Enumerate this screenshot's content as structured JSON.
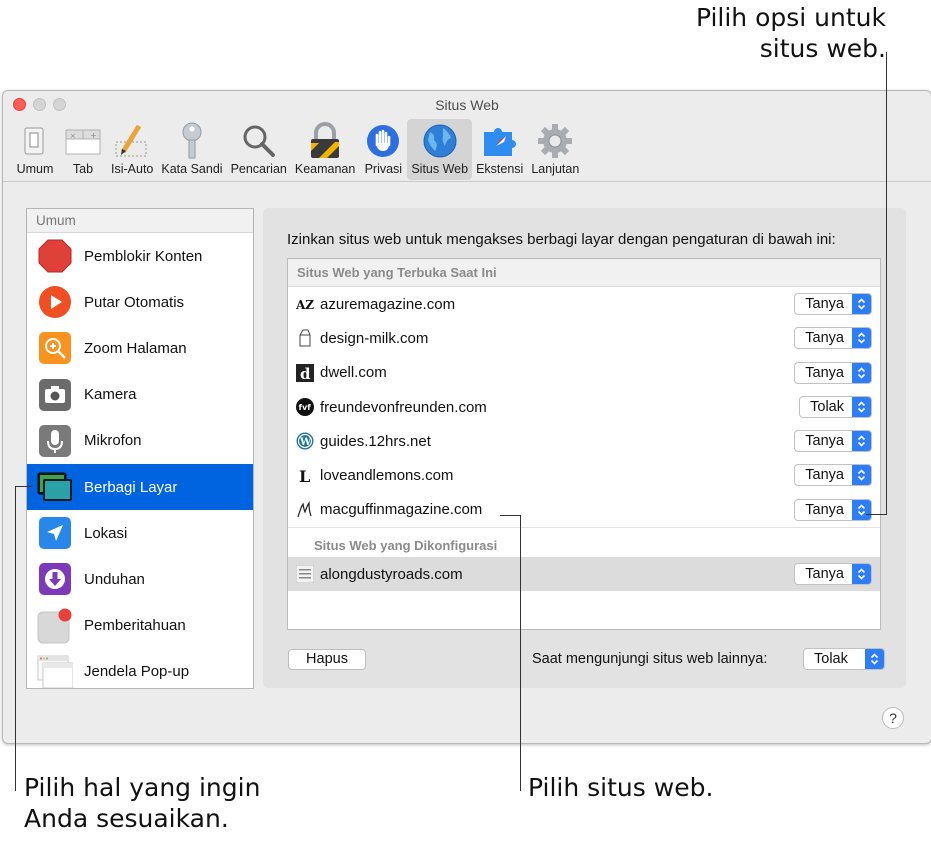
{
  "window": {
    "title": "Situs Web"
  },
  "toolbar": {
    "items": [
      {
        "label": "Umum",
        "icon": "switch-icon"
      },
      {
        "label": "Tab",
        "icon": "tabs-icon"
      },
      {
        "label": "Isi-Auto",
        "icon": "pencil-icon"
      },
      {
        "label": "Kata Sandi",
        "icon": "key-icon"
      },
      {
        "label": "Pencarian",
        "icon": "magnifier-icon"
      },
      {
        "label": "Keamanan",
        "icon": "lock-icon"
      },
      {
        "label": "Privasi",
        "icon": "hand-icon"
      },
      {
        "label": "Situs Web",
        "icon": "globe-icon",
        "active": true
      },
      {
        "label": "Ekstensi",
        "icon": "puzzle-compass-icon"
      },
      {
        "label": "Lanjutan",
        "icon": "gear-icon"
      }
    ]
  },
  "sidebar": {
    "header": "Umum",
    "items": [
      {
        "label": "Pemblokir Konten",
        "icon": "stop-sign-icon"
      },
      {
        "label": "Putar Otomatis",
        "icon": "play-icon"
      },
      {
        "label": "Zoom Halaman",
        "icon": "zoom-icon"
      },
      {
        "label": "Kamera",
        "icon": "camera-icon"
      },
      {
        "label": "Mikrofon",
        "icon": "microphone-icon"
      },
      {
        "label": "Berbagi Layar",
        "icon": "screen-share-icon",
        "selected": true
      },
      {
        "label": "Lokasi",
        "icon": "location-arrow-icon"
      },
      {
        "label": "Unduhan",
        "icon": "download-icon"
      },
      {
        "label": "Pemberitahuan",
        "icon": "notification-icon"
      },
      {
        "label": "Jendela Pop-up",
        "icon": "popup-window-icon"
      }
    ]
  },
  "main": {
    "instructions": "Izinkan situs web untuk mengakses berbagi layar dengan pengaturan di bawah ini:",
    "open_header": "Situs Web yang Terbuka Saat Ini",
    "configured_header": "Situs Web yang Dikonfigurasi",
    "open_sites": [
      {
        "name": "azuremagazine.com",
        "value": "Tanya",
        "icon": "az-favicon"
      },
      {
        "name": "design-milk.com",
        "value": "Tanya",
        "icon": "milk-carton-favicon"
      },
      {
        "name": "dwell.com",
        "value": "Tanya",
        "icon": "d-favicon"
      },
      {
        "name": "freundevonfreunden.com",
        "value": "Tolak",
        "icon": "fvf-favicon"
      },
      {
        "name": "guides.12hrs.net",
        "value": "Tanya",
        "icon": "wordpress-favicon"
      },
      {
        "name": "loveandlemons.com",
        "value": "Tanya",
        "icon": "l-favicon"
      },
      {
        "name": "macguffinmagazine.com",
        "value": "Tanya",
        "icon": "m-script-favicon"
      }
    ],
    "configured_sites": [
      {
        "name": "alongdustyroads.com",
        "value": "Tanya",
        "icon": "along-dusty-roads-favicon",
        "selected": true
      }
    ],
    "remove_button": "Hapus",
    "other_label": "Saat mengunjungi situs web lainnya:",
    "other_value": "Tolak",
    "help": "?"
  },
  "callouts": {
    "top_right": [
      "Pilih opsi untuk",
      "situs web."
    ],
    "bottom_left": [
      "Pilih hal yang ingin",
      "Anda sesuaikan."
    ],
    "bottom_middle": "Pilih situs web."
  },
  "colors": {
    "selection_blue": "#0064e1",
    "popup_blue": "#2d7df6",
    "close": "#fc5f57",
    "inactive_light": "#d5d5d5"
  }
}
